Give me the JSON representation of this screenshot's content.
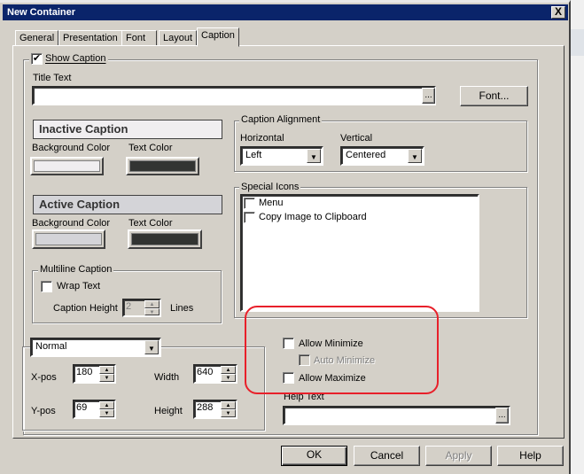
{
  "window": {
    "title": "New Container",
    "close_glyph": "X"
  },
  "tabs": [
    {
      "label": "General"
    },
    {
      "label": "Presentation"
    },
    {
      "label": "Font"
    },
    {
      "label": "Layout"
    },
    {
      "label": "Caption",
      "active": true
    }
  ],
  "show_caption": {
    "label": "Show Caption",
    "checked": true,
    "check_glyph": "✔"
  },
  "title_text": {
    "label": "Title Text",
    "value": "",
    "browse_label": "...",
    "font_button": "Font..."
  },
  "inactive_caption": {
    "heading": "Inactive Caption",
    "bg_label": "Background Color",
    "text_label": "Text Color",
    "bg_color": "#f0eef0",
    "text_color": "#323432"
  },
  "active_caption": {
    "heading": "Active Caption",
    "bg_label": "Background Color",
    "text_label": "Text Color",
    "bg_color": "#d4d4d8",
    "text_color": "#323432"
  },
  "multiline": {
    "label": "Multiline Caption",
    "wrap_label": "Wrap Text",
    "wrap_checked": false,
    "height_label": "Caption Height",
    "height_value": "2",
    "lines_label": "Lines"
  },
  "alignment": {
    "label": "Caption Alignment",
    "horizontal_label": "Horizontal",
    "horizontal_value": "Left",
    "vertical_label": "Vertical",
    "vertical_value": "Centered"
  },
  "special_icons": {
    "label": "Special Icons",
    "items": [
      {
        "label": "Menu",
        "checked": false
      },
      {
        "label": "Copy Image to Clipboard",
        "checked": false
      }
    ]
  },
  "position": {
    "mode": "Normal",
    "xpos_label": "X-pos",
    "xpos": "180",
    "ypos_label": "Y-pos",
    "ypos": "69",
    "width_label": "Width",
    "width": "640",
    "height_label": "Height",
    "height": "288"
  },
  "options": {
    "allow_minimize": "Allow Minimize",
    "auto_minimize": "Auto Minimize",
    "allow_maximize": "Allow Maximize"
  },
  "help_text": {
    "label": "Help Text",
    "value": "",
    "browse_label": "..."
  },
  "buttons": {
    "ok": "OK",
    "cancel": "Cancel",
    "apply": "Apply",
    "help": "Help"
  },
  "colors": {
    "titlebar": "#0a246a",
    "dialog": "#d4d0c8",
    "highlight_annotation": "#e8202a"
  }
}
